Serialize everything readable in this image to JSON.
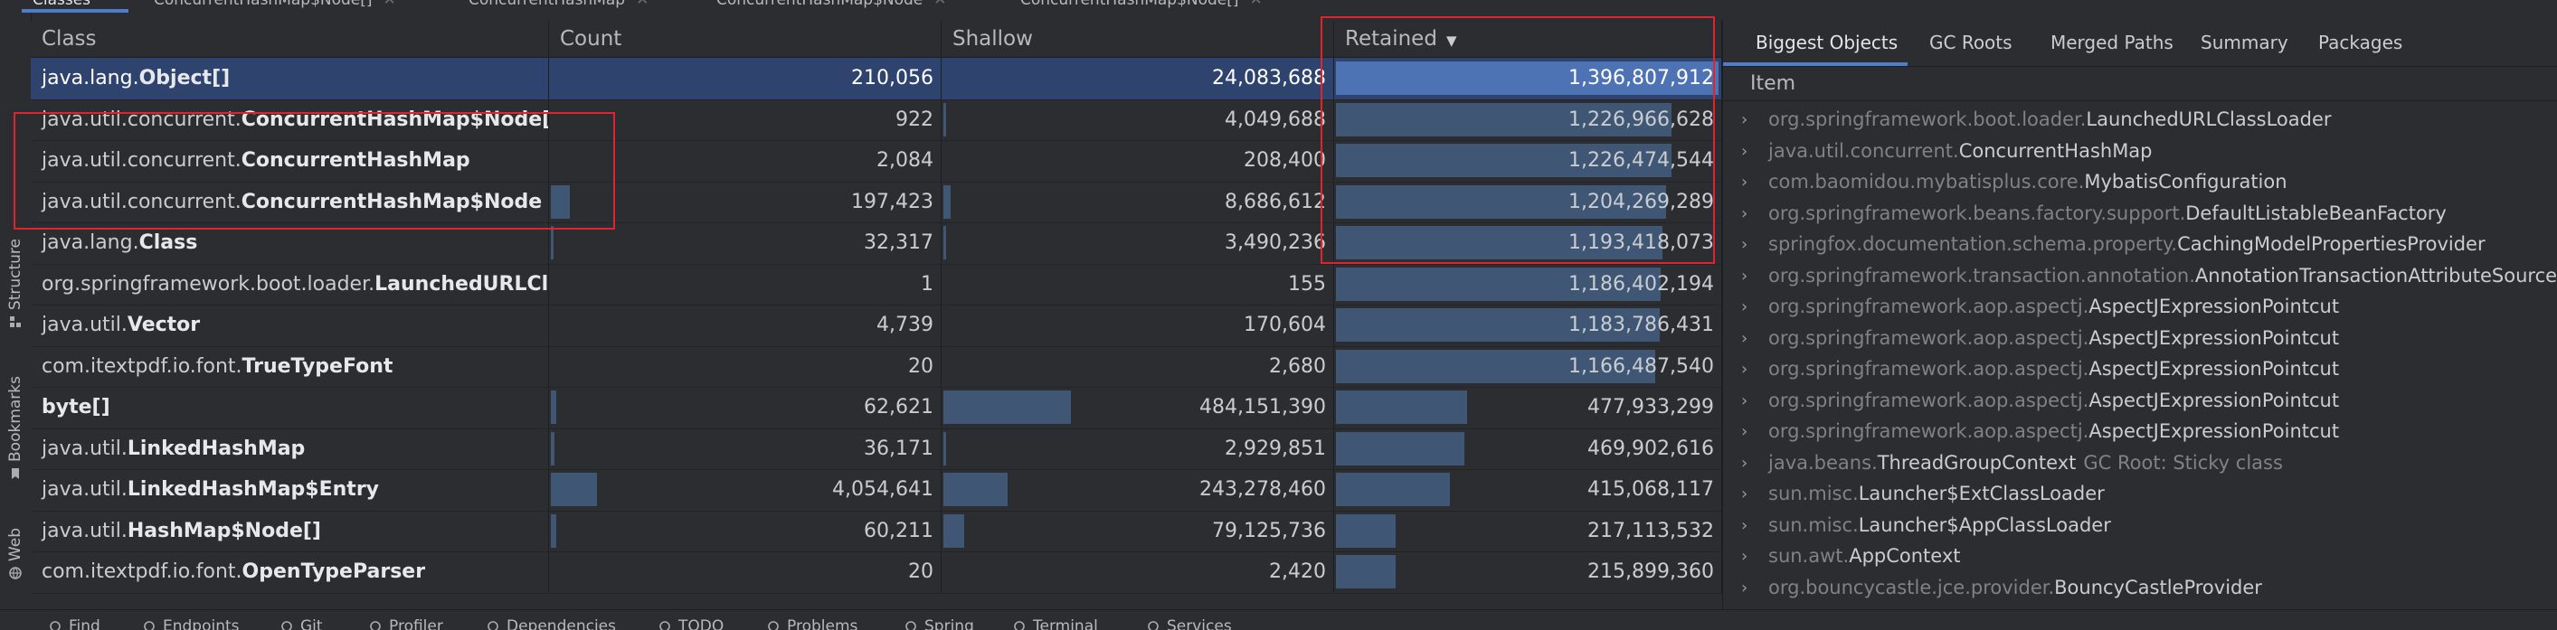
{
  "top_tabs": [
    {
      "label": "Classes"
    },
    {
      "label": "ConcurrentHashMap$Node[]"
    },
    {
      "label": "ConcurrentHashMap"
    },
    {
      "label": "ConcurrentHashMap$Node"
    },
    {
      "label": "ConcurrentHashMap$Node[]"
    }
  ],
  "left_tools": [
    {
      "label": "Structure",
      "icon": "structure-icon"
    },
    {
      "label": "Bookmarks",
      "icon": "bookmark-icon"
    },
    {
      "label": "Web",
      "icon": "web-icon"
    }
  ],
  "table": {
    "headers": {
      "class": "Class",
      "count": "Count",
      "shallow": "Shallow",
      "retained": "Retained"
    },
    "sort_indicator": "▼",
    "rows": [
      {
        "pkg": "java.lang.",
        "cls": "Object[]",
        "count": "210,056",
        "shallow": "24,083,688",
        "retained": "1,396,807,912",
        "count_bar": 0,
        "shallow_bar": 0,
        "retained_bar": 1.0,
        "selected": true
      },
      {
        "pkg": "java.util.concurrent.",
        "cls": "ConcurrentHashMap$Node[]",
        "count": "922",
        "shallow": "4,049,688",
        "retained": "1,226,966,628",
        "count_bar": 0,
        "shallow_bar": 0.008,
        "retained_bar": 0.878
      },
      {
        "pkg": "java.util.concurrent.",
        "cls": "ConcurrentHashMap",
        "count": "2,084",
        "shallow": "208,400",
        "retained": "1,226,474,544",
        "count_bar": 0,
        "shallow_bar": 0,
        "retained_bar": 0.878
      },
      {
        "pkg": "java.util.concurrent.",
        "cls": "ConcurrentHashMap$Node",
        "count": "197,423",
        "shallow": "8,686,612",
        "retained": "1,204,269,289",
        "count_bar": 0.049,
        "shallow_bar": 0.018,
        "retained_bar": 0.862
      },
      {
        "pkg": "java.lang.",
        "cls": "Class",
        "count": "32,317",
        "shallow": "3,490,236",
        "retained": "1,193,418,073",
        "count_bar": 0.008,
        "shallow_bar": 0.007,
        "retained_bar": 0.854
      },
      {
        "pkg": "org.springframework.boot.loader.",
        "cls": "LaunchedURLClass",
        "count": "1",
        "shallow": "155",
        "retained": "1,186,402,194",
        "count_bar": 0,
        "shallow_bar": 0,
        "retained_bar": 0.849
      },
      {
        "pkg": "java.util.",
        "cls": "Vector",
        "count": "4,739",
        "shallow": "170,604",
        "retained": "1,183,786,431",
        "count_bar": 0,
        "shallow_bar": 0,
        "retained_bar": 0.847
      },
      {
        "pkg": "com.itextpdf.io.font.",
        "cls": "TrueTypeFont",
        "count": "20",
        "shallow": "2,680",
        "retained": "1,166,487,540",
        "count_bar": 0,
        "shallow_bar": 0,
        "retained_bar": 0.835
      },
      {
        "pkg": "",
        "cls": "byte[]",
        "count": "62,621",
        "shallow": "484,151,390",
        "retained": "477,933,299",
        "count_bar": 0.015,
        "shallow_bar": 0.33,
        "retained_bar": 0.342
      },
      {
        "pkg": "java.util.",
        "cls": "LinkedHashMap",
        "count": "36,171",
        "shallow": "2,929,851",
        "retained": "469,902,616",
        "count_bar": 0.009,
        "shallow_bar": 0.006,
        "retained_bar": 0.336
      },
      {
        "pkg": "java.util.",
        "cls": "LinkedHashMap$Entry",
        "count": "4,054,641",
        "shallow": "243,278,460",
        "retained": "415,068,117",
        "count_bar": 0.12,
        "shallow_bar": 0.166,
        "retained_bar": 0.297
      },
      {
        "pkg": "java.util.",
        "cls": "HashMap$Node[]",
        "count": "60,211",
        "shallow": "79,125,736",
        "retained": "217,113,532",
        "count_bar": 0.015,
        "shallow_bar": 0.054,
        "retained_bar": 0.155
      },
      {
        "pkg": "com.itextpdf.io.font.",
        "cls": "OpenTypeParser",
        "count": "20",
        "shallow": "2,420",
        "retained": "215,899,360",
        "count_bar": 0,
        "shallow_bar": 0,
        "retained_bar": 0.155
      }
    ]
  },
  "right_panel": {
    "tabs": [
      {
        "label": "Biggest Objects",
        "active": true
      },
      {
        "label": "GC Roots"
      },
      {
        "label": "Merged Paths"
      },
      {
        "label": "Summary"
      },
      {
        "label": "Packages"
      }
    ],
    "column_header": "Item",
    "items": [
      {
        "pkg": "org.springframework.boot.loader.",
        "cls": "LaunchedURLClassLoader",
        "extra": ""
      },
      {
        "pkg": "java.util.concurrent.",
        "cls": "ConcurrentHashMap",
        "extra": ""
      },
      {
        "pkg": "com.baomidou.mybatisplus.core.",
        "cls": "MybatisConfiguration",
        "extra": ""
      },
      {
        "pkg": "org.springframework.beans.factory.support.",
        "cls": "DefaultListableBeanFactory",
        "extra": ""
      },
      {
        "pkg": "springfox.documentation.schema.property.",
        "cls": "CachingModelPropertiesProvider",
        "extra": ""
      },
      {
        "pkg": "org.springframework.transaction.annotation.",
        "cls": "AnnotationTransactionAttributeSource",
        "extra": ""
      },
      {
        "pkg": "org.springframework.aop.aspectj.",
        "cls": "AspectJExpressionPointcut",
        "extra": ""
      },
      {
        "pkg": "org.springframework.aop.aspectj.",
        "cls": "AspectJExpressionPointcut",
        "extra": ""
      },
      {
        "pkg": "org.springframework.aop.aspectj.",
        "cls": "AspectJExpressionPointcut",
        "extra": ""
      },
      {
        "pkg": "org.springframework.aop.aspectj.",
        "cls": "AspectJExpressionPointcut",
        "extra": ""
      },
      {
        "pkg": "org.springframework.aop.aspectj.",
        "cls": "AspectJExpressionPointcut",
        "extra": ""
      },
      {
        "pkg": "java.beans.",
        "cls": "ThreadGroupContext",
        "extra": "GC Root: Sticky class"
      },
      {
        "pkg": "sun.misc.",
        "cls": "Launcher$ExtClassLoader",
        "extra": ""
      },
      {
        "pkg": "sun.misc.",
        "cls": "Launcher$AppClassLoader",
        "extra": ""
      },
      {
        "pkg": "sun.awt.",
        "cls": "AppContext",
        "extra": ""
      },
      {
        "pkg": "org.bouncycastle.jce.provider.",
        "cls": "BouncyCastleProvider",
        "extra": ""
      }
    ]
  },
  "bottom_tools": [
    {
      "label": "Find",
      "icon": "search-icon"
    },
    {
      "label": "Endpoints",
      "icon": "endpoints-icon"
    },
    {
      "label": "Git",
      "icon": "git-icon"
    },
    {
      "label": "Profiler",
      "icon": "profiler-icon"
    },
    {
      "label": "Dependencies",
      "icon": "dependencies-icon"
    },
    {
      "label": "TODO",
      "icon": "todo-icon"
    },
    {
      "label": "Problems",
      "icon": "problems-icon"
    },
    {
      "label": "Spring",
      "icon": "spring-icon"
    },
    {
      "label": "Terminal",
      "icon": "terminal-icon"
    },
    {
      "label": "Services",
      "icon": "services-icon"
    }
  ],
  "colors": {
    "accent": "#4e7ec9",
    "highlight": "#e0242e",
    "selection": "#2e436e",
    "bar": "#3f5674"
  }
}
